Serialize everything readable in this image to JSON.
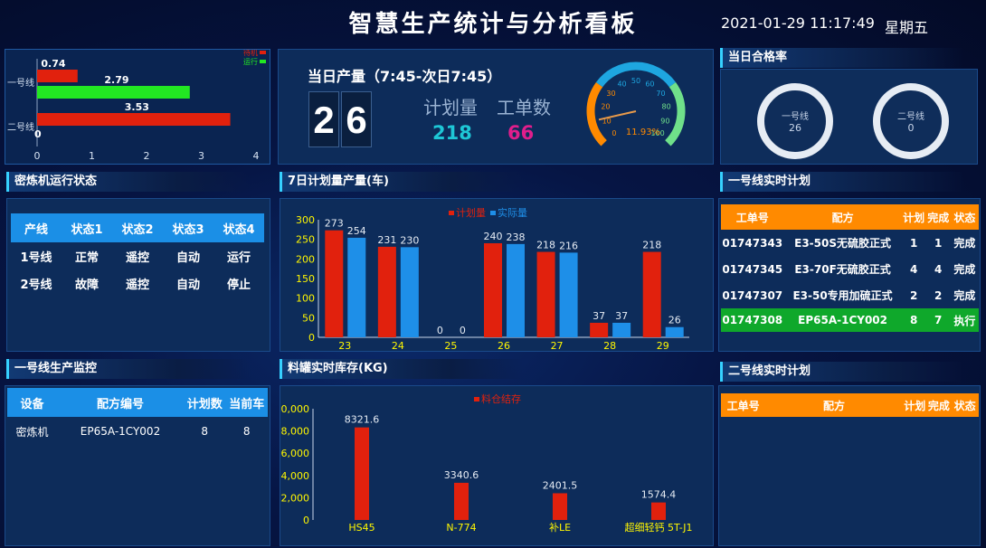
{
  "header": {
    "title": "智慧生产统计与分析看板",
    "datetime": "2021-01-29 11:17:49",
    "weekday": "星期五"
  },
  "wait_chart": {
    "legend": [
      "待机",
      "运行"
    ],
    "categories": [
      "一号线",
      "二号线"
    ],
    "bars": [
      {
        "line": "一号线",
        "status": "待机",
        "value": 0.74
      },
      {
        "line": "一号线",
        "status": "运行",
        "value": 2.79
      },
      {
        "line": "二号线",
        "status": "待机",
        "value": 3.53
      },
      {
        "line": "二号线",
        "status": "运行",
        "value": 0
      }
    ],
    "xticks": [
      "0",
      "1",
      "2",
      "3",
      "4"
    ]
  },
  "daily_output": {
    "title": "当日产量（7:45-次日7:45）",
    "digits": [
      "2",
      "6"
    ],
    "plan_label": "计划量",
    "plan_value": "218",
    "orders_label": "工单数",
    "orders_value": "66",
    "gauge": {
      "value": 11.93,
      "label": "11.93%",
      "ticks": [
        "0",
        "10",
        "20",
        "30",
        "40",
        "50",
        "60",
        "70",
        "80",
        "90",
        "100"
      ]
    }
  },
  "pass_rate": {
    "title": "当日合格率",
    "lines": [
      {
        "name": "一号线",
        "value": "26"
      },
      {
        "name": "二号线",
        "value": "0"
      }
    ]
  },
  "mixer_status": {
    "title": "密炼机运行状态",
    "headers": [
      "产线",
      "状态1",
      "状态2",
      "状态3",
      "状态4"
    ],
    "rows": [
      [
        "1号线",
        "正常",
        "遥控",
        "自动",
        "运行"
      ],
      [
        "2号线",
        "故障",
        "遥控",
        "自动",
        "停止"
      ]
    ]
  },
  "week_chart_title": "7日计划量产量(车)",
  "line1_plan": {
    "title": "一号线实时计划",
    "headers": [
      "工单号",
      "配方",
      "计划",
      "完成",
      "状态"
    ],
    "rows": [
      [
        "01747343",
        "E3-50S无硫胶正式",
        "1",
        "1",
        "完成"
      ],
      [
        "01747345",
        "E3-70F无硫胶正式",
        "4",
        "4",
        "完成"
      ],
      [
        "01747307",
        "E3-50专用加硫正式",
        "2",
        "2",
        "完成"
      ],
      [
        "01747308",
        "EP65A-1CY002",
        "8",
        "7",
        "执行"
      ]
    ]
  },
  "line1_monitor": {
    "title": "一号线生产监控",
    "headers": [
      "设备",
      "配方编号",
      "计划数",
      "当前车"
    ],
    "rows": [
      [
        "密炼机",
        "EP65A-1CY002",
        "8",
        "8"
      ]
    ]
  },
  "tank_chart_title": "料罐实时库存(KG)",
  "line2_plan": {
    "title": "二号线实时计划",
    "headers": [
      "工单号",
      "配方",
      "计划",
      "完成",
      "状态"
    ]
  },
  "colors": {
    "plan": "#e1210d",
    "actual": "#1e8fe8",
    "run": "#22e822",
    "header_orange": "#ff8a00",
    "exec_green": "#0fa82b",
    "table_header_blue": "#1b8fe6"
  },
  "chart_data": [
    {
      "type": "bar",
      "title": "7日计划量产量(车)",
      "legend": [
        "计划量",
        "实际量"
      ],
      "categories": [
        "23",
        "24",
        "25",
        "26",
        "27",
        "28",
        "29"
      ],
      "series": [
        {
          "name": "计划量",
          "values": [
            273,
            231,
            0,
            240,
            218,
            37,
            218
          ]
        },
        {
          "name": "实际量",
          "values": [
            254,
            230,
            0,
            238,
            216,
            37,
            26
          ]
        }
      ],
      "yticks": [
        "0",
        "50",
        "100",
        "150",
        "200",
        "250",
        "300"
      ],
      "ylim": [
        0,
        300
      ]
    },
    {
      "type": "bar",
      "title": "料罐实时库存(KG)",
      "legend": [
        "料仓结存"
      ],
      "categories": [
        "HS45",
        "N-774",
        "补LE",
        "超细轻钙 5T-J1"
      ],
      "series": [
        {
          "name": "料仓结存",
          "values": [
            8321.6,
            3340.6,
            2401.5,
            1574.4
          ]
        }
      ],
      "yticks": [
        "0",
        "2,000",
        "4,000",
        "6,000",
        "8,000",
        "0,000"
      ],
      "ylim": [
        0,
        10000
      ]
    }
  ]
}
